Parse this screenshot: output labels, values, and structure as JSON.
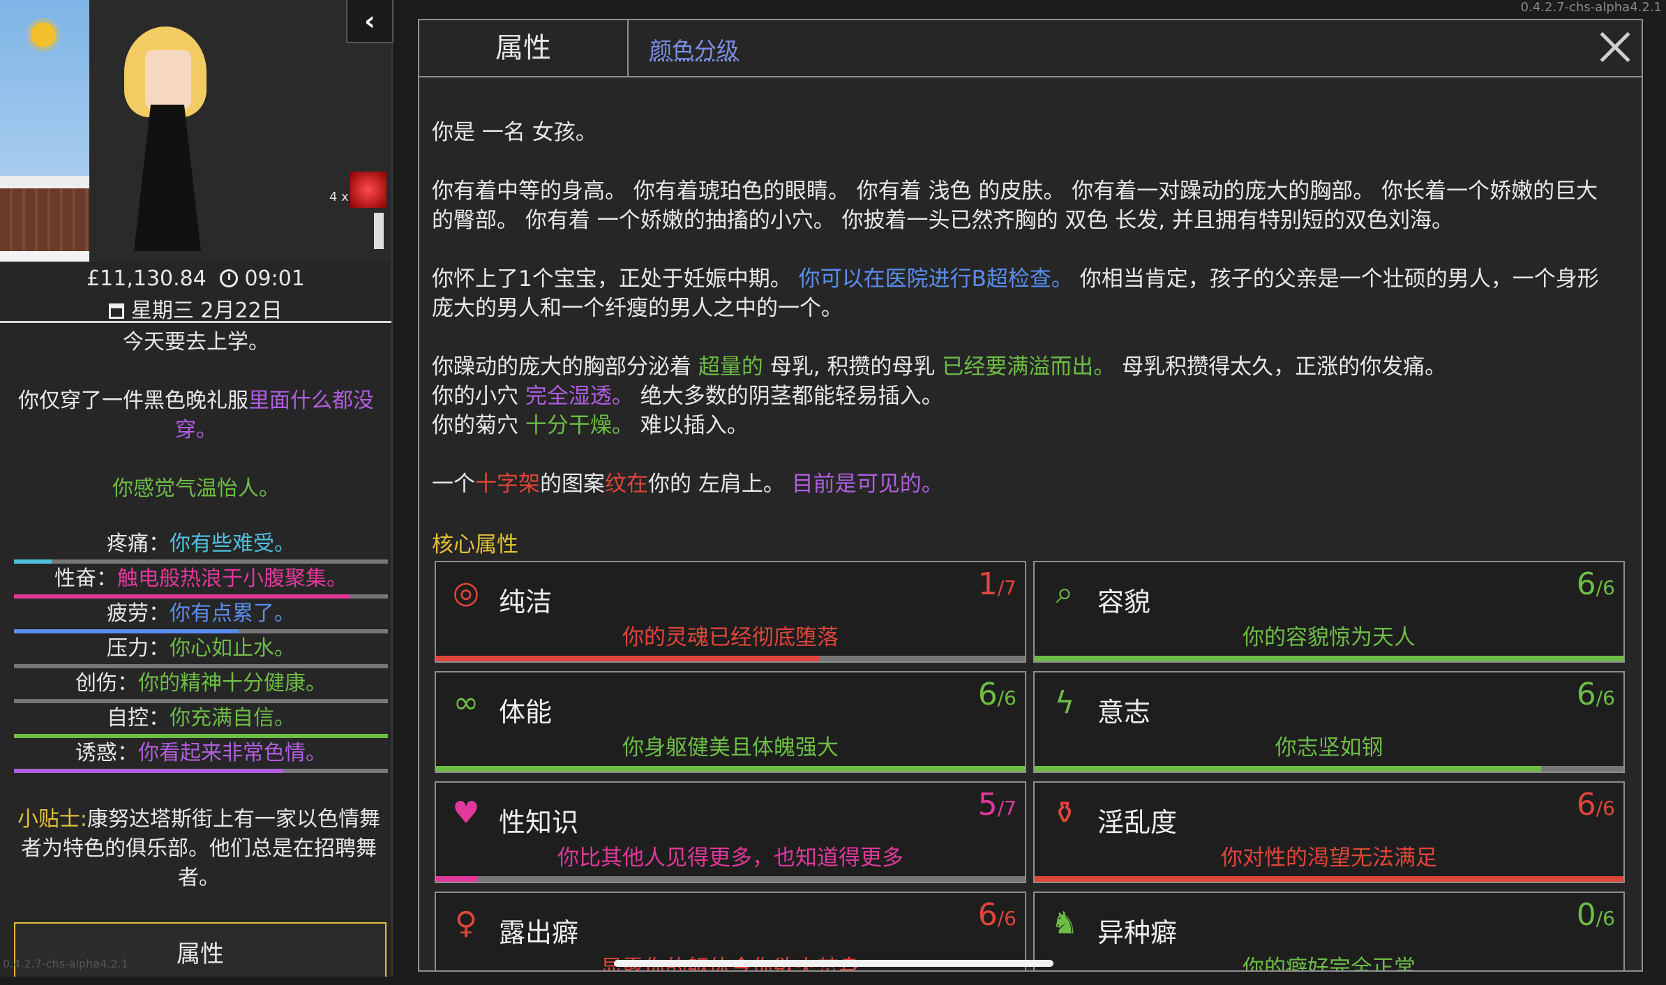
{
  "version": "0.4.2.7-chs-alpha4.2.1",
  "sidebar": {
    "multiplier": "4 x",
    "money": "£11,130.84",
    "time": "09:01",
    "date": "星期三 2月22日",
    "school_note": "今天要去上学。",
    "clothing_a": "你仅穿了一件黑色晚礼服",
    "clothing_b": "里面什么都没穿。",
    "weather": "你感觉气温怡人。",
    "stats": [
      {
        "label": "疼痛：",
        "text": "你有些难受。",
        "color": "#4fc1e0",
        "fill": 0.1
      },
      {
        "label": "性奋：",
        "text": "触电般热浪于小腹聚集。",
        "color": "#e0399b",
        "fill": 0.9
      },
      {
        "label": "疲劳：",
        "text": "你有点累了。",
        "color": "#5b8dee",
        "fill": 0.6
      },
      {
        "label": "压力：",
        "text": "你心如止水。",
        "color": "#6dbd45",
        "fill": 0.0
      },
      {
        "label": "创伤：",
        "text": "你的精神十分健康。",
        "color": "#6dbd45",
        "fill": 0.0
      },
      {
        "label": "自控：",
        "text": "你充满自信。",
        "color": "#6dbd45",
        "fill": 1.0
      },
      {
        "label": "诱惑：",
        "text": "你看起来非常色情。",
        "color": "#b05ee0",
        "fill": 0.72
      }
    ],
    "tip_label": "小贴士:",
    "tip_text": "康努达塔斯街上有一家以色情舞者为特色的俱乐部。他们总是在招聘舞者。",
    "tab_label": "属性",
    "watermark": "0.4.2.7-chs-alpha4.2.1"
  },
  "panel": {
    "tab_active": "属性",
    "tab_link": "颜色分级",
    "p1": "你是 一名 女孩。",
    "p2": "你有着中等的身高。 你有着琥珀色的眼睛。 你有着 浅色 的皮肤。 你有着一对躁动的庞大的胸部。 你长着一个娇嫩的巨大的臀部。 你有着 一个娇嫩的抽搐的小穴。 你披着一头已然齐胸的 双色 长发, 并且拥有特别短的双色刘海。",
    "p3a": "你怀上了1个宝宝，正处于妊娠中期。",
    "p3b": "你可以在医院进行B超检查。",
    "p3c": "你相当肯定，孩子的父亲是一个壮硕的男人，一个身形庞大的男人和一个纤瘦的男人之中的一个。",
    "p4a": "你躁动的庞大的胸部分泌着",
    "p4b": "超量的",
    "p4c": "母乳, 积攒的母乳",
    "p4d": "已经要满溢而出。",
    "p4e": "母乳积攒得太久，正涨的你发痛。",
    "p5a": "你的小穴",
    "p5b": "完全湿透。",
    "p5c": "绝大多数的阴茎都能轻易插入。",
    "p6a": "你的菊穴",
    "p6b": "十分干燥。",
    "p6c": "难以插入。",
    "p7a": "一个",
    "p7b": "十字架",
    "p7c": "的图案",
    "p7d": "纹在",
    "p7e": "你的 左肩上。",
    "p7f": "目前是可见的。",
    "core_title": "核心属性",
    "cards": [
      {
        "name": "纯洁",
        "value": "1",
        "max": "/7",
        "desc": "你的灵魂已经彻底堕落",
        "color": "#e0453a",
        "icon": "halo-icon",
        "glyph": "◎",
        "fill": 0.65
      },
      {
        "name": "容貌",
        "value": "6",
        "max": "/6",
        "desc": "你的容貌惊为天人",
        "color": "#6dbd45",
        "icon": "mirror-icon",
        "glyph": "⌕",
        "fill": 1.0
      },
      {
        "name": "体能",
        "value": "6",
        "max": "/6",
        "desc": "你身躯健美且体魄强大",
        "color": "#6dbd45",
        "icon": "cuffs-icon",
        "glyph": "∞",
        "fill": 1.0
      },
      {
        "name": "意志",
        "value": "6",
        "max": "/6",
        "desc": "你志坚如钢",
        "color": "#6dbd45",
        "icon": "lightning-icon",
        "glyph": "ϟ",
        "fill": 0.86
      },
      {
        "name": "性知识",
        "value": "5",
        "max": "/7",
        "desc": "你比其他人见得更多，也知道得更多",
        "color": "#e0399b",
        "icon": "heart-head-icon",
        "glyph": "♥",
        "fill": 0.07
      },
      {
        "name": "淫乱度",
        "value": "6",
        "max": "/6",
        "desc": "你对性的渴望无法满足",
        "color": "#e0453a",
        "icon": "potion-icon",
        "glyph": "⚱",
        "fill": 1.0
      },
      {
        "name": "露出癖",
        "value": "6",
        "max": "/6",
        "desc": "显露你的躯体令你欲火焚身",
        "color": "#e0453a",
        "icon": "figure-icon",
        "glyph": "♀",
        "fill": 1.0
      },
      {
        "name": "异种癖",
        "value": "0",
        "max": "/6",
        "desc": "你的癖好完全正常",
        "color": "#6dbd45",
        "icon": "beast-icon",
        "glyph": "♞",
        "fill": 0.0
      }
    ]
  }
}
